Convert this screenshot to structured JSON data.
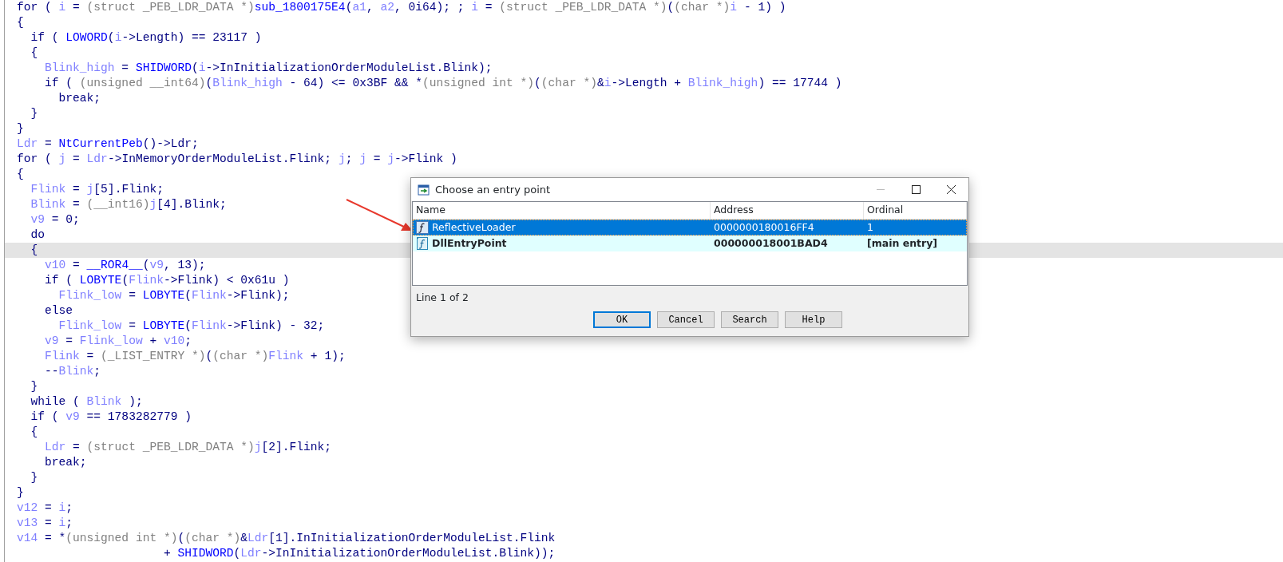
{
  "code": {
    "lines": [
      {
        "highlighted": false,
        "tokens": [
          {
            "kind": "plain",
            "text": "for ( "
          },
          {
            "kind": "var",
            "text": "i"
          },
          {
            "kind": "plain",
            "text": " = "
          },
          {
            "kind": "type",
            "text": "(struct _PEB_LDR_DATA *)"
          },
          {
            "kind": "func",
            "text": "sub_1800175E4"
          },
          {
            "kind": "plain",
            "text": "("
          },
          {
            "kind": "var",
            "text": "a1"
          },
          {
            "kind": "plain",
            "text": ", "
          },
          {
            "kind": "var",
            "text": "a2"
          },
          {
            "kind": "plain",
            "text": ", 0i64); ; "
          },
          {
            "kind": "var",
            "text": "i"
          },
          {
            "kind": "plain",
            "text": " = "
          },
          {
            "kind": "type",
            "text": "(struct _PEB_LDR_DATA *)"
          },
          {
            "kind": "plain",
            "text": "("
          },
          {
            "kind": "type",
            "text": "(char *)"
          },
          {
            "kind": "var",
            "text": "i"
          },
          {
            "kind": "plain",
            "text": " - 1) )"
          }
        ]
      },
      {
        "highlighted": false,
        "tokens": [
          {
            "kind": "plain",
            "text": "{"
          }
        ]
      },
      {
        "highlighted": false,
        "tokens": [
          {
            "kind": "plain",
            "text": "  if ( "
          },
          {
            "kind": "func",
            "text": "LOWORD"
          },
          {
            "kind": "plain",
            "text": "("
          },
          {
            "kind": "var",
            "text": "i"
          },
          {
            "kind": "plain",
            "text": "->Length) == 23117 )"
          }
        ]
      },
      {
        "highlighted": false,
        "tokens": [
          {
            "kind": "plain",
            "text": "  {"
          }
        ]
      },
      {
        "highlighted": false,
        "tokens": [
          {
            "kind": "var",
            "text": "    Blink_high"
          },
          {
            "kind": "plain",
            "text": " = "
          },
          {
            "kind": "func",
            "text": "SHIDWORD"
          },
          {
            "kind": "plain",
            "text": "("
          },
          {
            "kind": "var",
            "text": "i"
          },
          {
            "kind": "plain",
            "text": "->InInitializationOrderModuleList.Blink);"
          }
        ]
      },
      {
        "highlighted": false,
        "tokens": [
          {
            "kind": "plain",
            "text": "    if ( "
          },
          {
            "kind": "type",
            "text": "(unsigned __int64)"
          },
          {
            "kind": "plain",
            "text": "("
          },
          {
            "kind": "var",
            "text": "Blink_high"
          },
          {
            "kind": "plain",
            "text": " - 64) <= 0x3BF && *"
          },
          {
            "kind": "type",
            "text": "(unsigned int *)"
          },
          {
            "kind": "plain",
            "text": "("
          },
          {
            "kind": "type",
            "text": "(char *)"
          },
          {
            "kind": "plain",
            "text": "&"
          },
          {
            "kind": "var",
            "text": "i"
          },
          {
            "kind": "plain",
            "text": "->Length + "
          },
          {
            "kind": "var",
            "text": "Blink_high"
          },
          {
            "kind": "plain",
            "text": ") == 17744 )"
          }
        ]
      },
      {
        "highlighted": false,
        "tokens": [
          {
            "kind": "plain",
            "text": "      break;"
          }
        ]
      },
      {
        "highlighted": false,
        "tokens": [
          {
            "kind": "plain",
            "text": "  }"
          }
        ]
      },
      {
        "highlighted": false,
        "tokens": [
          {
            "kind": "plain",
            "text": "}"
          }
        ]
      },
      {
        "highlighted": false,
        "tokens": [
          {
            "kind": "var",
            "text": "Ldr"
          },
          {
            "kind": "plain",
            "text": " = "
          },
          {
            "kind": "func",
            "text": "NtCurrentPeb"
          },
          {
            "kind": "plain",
            "text": "()->Ldr;"
          }
        ]
      },
      {
        "highlighted": false,
        "tokens": [
          {
            "kind": "plain",
            "text": "for ( "
          },
          {
            "kind": "var",
            "text": "j"
          },
          {
            "kind": "plain",
            "text": " = "
          },
          {
            "kind": "var",
            "text": "Ldr"
          },
          {
            "kind": "plain",
            "text": "->InMemoryOrderModuleList.Flink; "
          },
          {
            "kind": "var",
            "text": "j"
          },
          {
            "kind": "plain",
            "text": "; "
          },
          {
            "kind": "var",
            "text": "j"
          },
          {
            "kind": "plain",
            "text": " = "
          },
          {
            "kind": "var",
            "text": "j"
          },
          {
            "kind": "plain",
            "text": "->Flink )"
          }
        ]
      },
      {
        "highlighted": false,
        "tokens": [
          {
            "kind": "plain",
            "text": "{"
          }
        ]
      },
      {
        "highlighted": false,
        "tokens": [
          {
            "kind": "var",
            "text": "  Flink"
          },
          {
            "kind": "plain",
            "text": " = "
          },
          {
            "kind": "var",
            "text": "j"
          },
          {
            "kind": "plain",
            "text": "[5].Flink;"
          }
        ]
      },
      {
        "highlighted": false,
        "tokens": [
          {
            "kind": "var",
            "text": "  Blink"
          },
          {
            "kind": "plain",
            "text": " = "
          },
          {
            "kind": "type",
            "text": "(__int16)"
          },
          {
            "kind": "var",
            "text": "j"
          },
          {
            "kind": "plain",
            "text": "[4].Blink;"
          }
        ]
      },
      {
        "highlighted": false,
        "tokens": [
          {
            "kind": "var",
            "text": "  v9"
          },
          {
            "kind": "plain",
            "text": " = 0;"
          }
        ]
      },
      {
        "highlighted": false,
        "tokens": [
          {
            "kind": "plain",
            "text": "  do"
          }
        ]
      },
      {
        "highlighted": true,
        "tokens": [
          {
            "kind": "plain",
            "text": "  {"
          }
        ]
      },
      {
        "highlighted": false,
        "tokens": [
          {
            "kind": "var",
            "text": "    v10"
          },
          {
            "kind": "plain",
            "text": " = "
          },
          {
            "kind": "func",
            "text": "__ROR4__"
          },
          {
            "kind": "plain",
            "text": "("
          },
          {
            "kind": "var",
            "text": "v9"
          },
          {
            "kind": "plain",
            "text": ", 13);"
          }
        ]
      },
      {
        "highlighted": false,
        "tokens": [
          {
            "kind": "plain",
            "text": "    if ( "
          },
          {
            "kind": "func",
            "text": "LOBYTE"
          },
          {
            "kind": "plain",
            "text": "("
          },
          {
            "kind": "var",
            "text": "Flink"
          },
          {
            "kind": "plain",
            "text": "->Flink) < 0x61u )"
          }
        ]
      },
      {
        "highlighted": false,
        "tokens": [
          {
            "kind": "var",
            "text": "      Flink_low"
          },
          {
            "kind": "plain",
            "text": " = "
          },
          {
            "kind": "func",
            "text": "LOBYTE"
          },
          {
            "kind": "plain",
            "text": "("
          },
          {
            "kind": "var",
            "text": "Flink"
          },
          {
            "kind": "plain",
            "text": "->Flink);"
          }
        ]
      },
      {
        "highlighted": false,
        "tokens": [
          {
            "kind": "plain",
            "text": "    else"
          }
        ]
      },
      {
        "highlighted": false,
        "tokens": [
          {
            "kind": "var",
            "text": "      Flink_low"
          },
          {
            "kind": "plain",
            "text": " = "
          },
          {
            "kind": "func",
            "text": "LOBYTE"
          },
          {
            "kind": "plain",
            "text": "("
          },
          {
            "kind": "var",
            "text": "Flink"
          },
          {
            "kind": "plain",
            "text": "->Flink) - 32;"
          }
        ]
      },
      {
        "highlighted": false,
        "tokens": [
          {
            "kind": "var",
            "text": "    v9"
          },
          {
            "kind": "plain",
            "text": " = "
          },
          {
            "kind": "var",
            "text": "Flink_low"
          },
          {
            "kind": "plain",
            "text": " + "
          },
          {
            "kind": "var",
            "text": "v10"
          },
          {
            "kind": "plain",
            "text": ";"
          }
        ]
      },
      {
        "highlighted": false,
        "tokens": [
          {
            "kind": "var",
            "text": "    Flink"
          },
          {
            "kind": "plain",
            "text": " = "
          },
          {
            "kind": "type",
            "text": "(_LIST_ENTRY *)"
          },
          {
            "kind": "plain",
            "text": "("
          },
          {
            "kind": "type",
            "text": "(char *)"
          },
          {
            "kind": "var",
            "text": "Flink"
          },
          {
            "kind": "plain",
            "text": " + 1);"
          }
        ]
      },
      {
        "highlighted": false,
        "tokens": [
          {
            "kind": "plain",
            "text": "    --"
          },
          {
            "kind": "var",
            "text": "Blink"
          },
          {
            "kind": "plain",
            "text": ";"
          }
        ]
      },
      {
        "highlighted": false,
        "tokens": [
          {
            "kind": "plain",
            "text": "  }"
          }
        ]
      },
      {
        "highlighted": false,
        "tokens": [
          {
            "kind": "plain",
            "text": "  while ( "
          },
          {
            "kind": "var",
            "text": "Blink"
          },
          {
            "kind": "plain",
            "text": " );"
          }
        ]
      },
      {
        "highlighted": false,
        "tokens": [
          {
            "kind": "plain",
            "text": "  if ( "
          },
          {
            "kind": "var",
            "text": "v9"
          },
          {
            "kind": "plain",
            "text": " == 1783282779 )"
          }
        ]
      },
      {
        "highlighted": false,
        "tokens": [
          {
            "kind": "plain",
            "text": "  {"
          }
        ]
      },
      {
        "highlighted": false,
        "tokens": [
          {
            "kind": "var",
            "text": "    Ldr"
          },
          {
            "kind": "plain",
            "text": " = "
          },
          {
            "kind": "type",
            "text": "(struct _PEB_LDR_DATA *)"
          },
          {
            "kind": "var",
            "text": "j"
          },
          {
            "kind": "plain",
            "text": "[2].Flink;"
          }
        ]
      },
      {
        "highlighted": false,
        "tokens": [
          {
            "kind": "plain",
            "text": "    break;"
          }
        ]
      },
      {
        "highlighted": false,
        "tokens": [
          {
            "kind": "plain",
            "text": "  }"
          }
        ]
      },
      {
        "highlighted": false,
        "tokens": [
          {
            "kind": "plain",
            "text": "}"
          }
        ]
      },
      {
        "highlighted": false,
        "tokens": [
          {
            "kind": "var",
            "text": "v12"
          },
          {
            "kind": "plain",
            "text": " = "
          },
          {
            "kind": "var",
            "text": "i"
          },
          {
            "kind": "plain",
            "text": ";"
          }
        ]
      },
      {
        "highlighted": false,
        "tokens": [
          {
            "kind": "var",
            "text": "v13"
          },
          {
            "kind": "plain",
            "text": " = "
          },
          {
            "kind": "var",
            "text": "i"
          },
          {
            "kind": "plain",
            "text": ";"
          }
        ]
      },
      {
        "highlighted": false,
        "tokens": [
          {
            "kind": "var",
            "text": "v14"
          },
          {
            "kind": "plain",
            "text": " = *"
          },
          {
            "kind": "type",
            "text": "(unsigned int *)"
          },
          {
            "kind": "plain",
            "text": "("
          },
          {
            "kind": "type",
            "text": "(char *)"
          },
          {
            "kind": "plain",
            "text": "&"
          },
          {
            "kind": "var",
            "text": "Ldr"
          },
          {
            "kind": "plain",
            "text": "[1].InInitializationOrderModuleList.Flink"
          }
        ]
      },
      {
        "highlighted": false,
        "tokens": [
          {
            "kind": "plain",
            "text": "                     + "
          },
          {
            "kind": "func",
            "text": "SHIDWORD"
          },
          {
            "kind": "plain",
            "text": "("
          },
          {
            "kind": "var",
            "text": "Ldr"
          },
          {
            "kind": "plain",
            "text": "->InInitializationOrderModuleList.Blink));"
          }
        ]
      }
    ]
  },
  "dialog": {
    "title": "Choose an entry point",
    "columns": [
      "Name",
      "Address",
      "Ordinal"
    ],
    "rows": [
      {
        "kind": "function",
        "name": "ReflectiveLoader",
        "address": "0000000180016FF4",
        "ordinal": "1",
        "selected": true
      },
      {
        "kind": "entry",
        "name": "DllEntryPoint",
        "address": "000000018001BAD4",
        "ordinal": "[main entry]",
        "selected": false
      }
    ],
    "status": "Line 1 of 2",
    "buttons": [
      "OK",
      "Cancel",
      "Search",
      "Help"
    ]
  }
}
